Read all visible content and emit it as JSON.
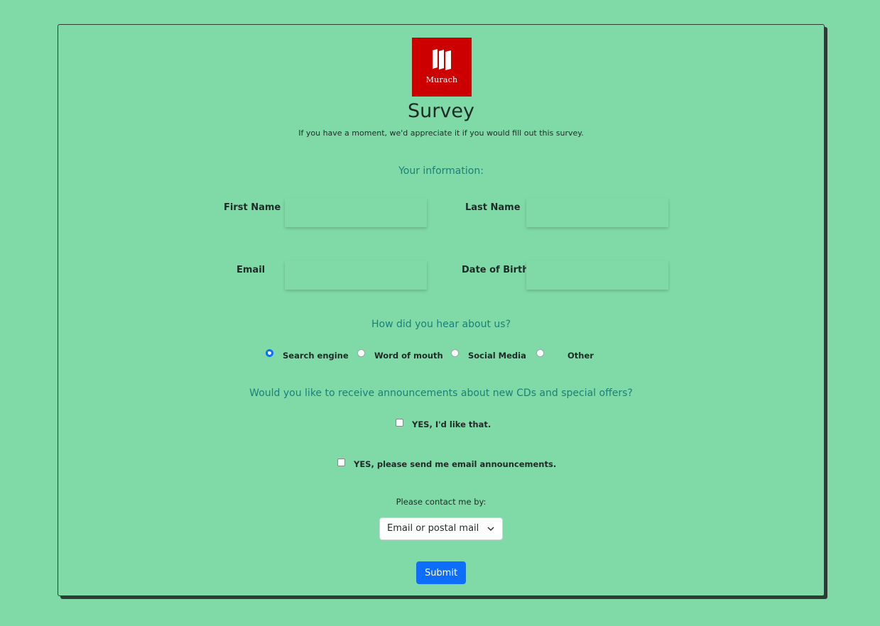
{
  "logo": {
    "text": "Murach",
    "color": "#cc0000"
  },
  "header": {
    "title": "Survey",
    "subtitle": "If you have a moment, we'd appreciate it if you would fill out this survey."
  },
  "info_section": {
    "heading": "Your information:",
    "first_name_label": "First Name",
    "first_name_value": "",
    "last_name_label": "Last Name",
    "last_name_value": "",
    "email_label": "Email",
    "email_value": "",
    "dob_label": "Date of Birth",
    "dob_value": ""
  },
  "hear_section": {
    "heading": "How did you hear about us?",
    "options": [
      {
        "label": "Search engine",
        "checked": true
      },
      {
        "label": "Word of mouth",
        "checked": false
      },
      {
        "label": "Social Media",
        "checked": false
      },
      {
        "label": "Other",
        "checked": false
      }
    ]
  },
  "announce_section": {
    "heading": "Would you like to receive announcements about new CDs and special offers?",
    "checkbox1_label": "YES, I'd like that.",
    "checkbox1_checked": false,
    "checkbox2_label": "YES, please send me email announcements.",
    "checkbox2_checked": false
  },
  "contact": {
    "label": "Please contact me by:",
    "selected": "Email or postal mail"
  },
  "submit_label": "Submit",
  "colors": {
    "background": "#80daa7",
    "heading": "#1b8079",
    "accent": "#0d6efd"
  }
}
